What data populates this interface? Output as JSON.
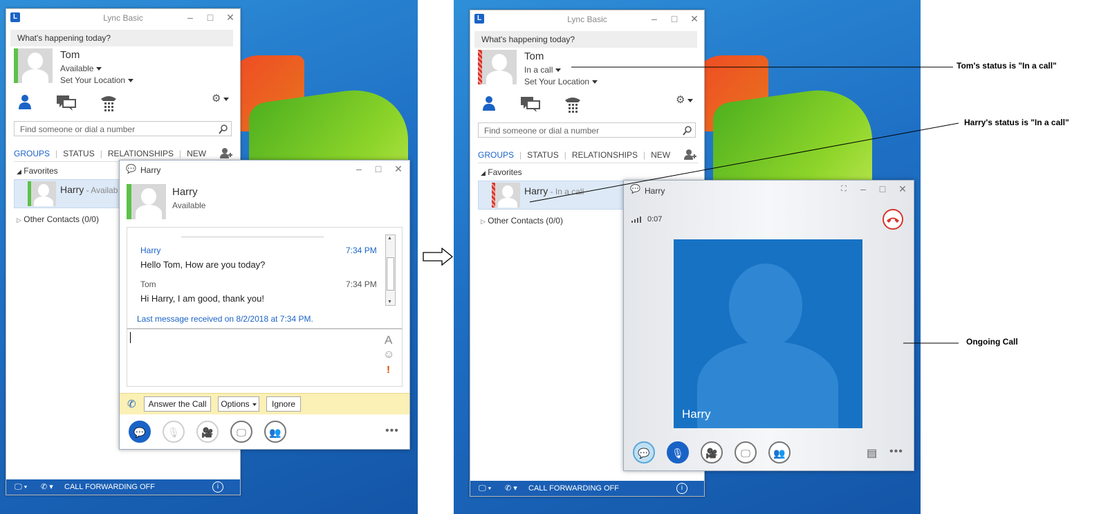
{
  "left": {
    "window_title": "Lync Basic",
    "happening": "What's happening today?",
    "user_name": "Tom",
    "status": "Available",
    "location": "Set Your Location",
    "search_placeholder": "Find someone or dial a number",
    "tabs": [
      "GROUPS",
      "STATUS",
      "RELATIONSHIPS",
      "NEW"
    ],
    "favorites": "Favorites",
    "contact_name": "Harry",
    "contact_status": "- Availab",
    "other_contacts": "Other Contacts (0/0)",
    "call_forwarding": "CALL FORWARDING OFF",
    "conversation": {
      "title": "Harry",
      "name": "Harry",
      "status": "Available",
      "messages": [
        {
          "from": "Harry",
          "time": "7:34 PM",
          "text": "Hello Tom, How are you today?"
        },
        {
          "from": "Tom",
          "time": "7:34 PM",
          "text": "Hi Harry, I am good, thank you!"
        }
      ],
      "last_received": "Last message received on 8/2/2018 at 7:34 PM.",
      "answer": "Answer the Call",
      "options": "Options",
      "ignore": "Ignore"
    }
  },
  "right": {
    "window_title": "Lync Basic",
    "happening": "What's happening today?",
    "user_name": "Tom",
    "status": "In a call",
    "location": "Set Your Location",
    "search_placeholder": "Find someone or dial a number",
    "tabs": [
      "GROUPS",
      "STATUS",
      "RELATIONSHIPS",
      "NEW"
    ],
    "favorites": "Favorites",
    "contact_name": "Harry",
    "contact_status": "- In a call",
    "other_contacts": "Other Contacts (0/0)",
    "call_forwarding": "CALL FORWARDING OFF",
    "call": {
      "title": "Harry",
      "duration": "0:07",
      "video_name": "Harry"
    }
  },
  "annotations": {
    "tom_status": "Tom's status is \"In a call\"",
    "harry_status": "Harry's status is \"In a call\"",
    "ongoing": "Ongoing Call"
  },
  "colors": {
    "accent": "#1a63c6",
    "available": "#5dc14a",
    "busy": "#d9342b",
    "statusbar": "#1a5fb4"
  }
}
